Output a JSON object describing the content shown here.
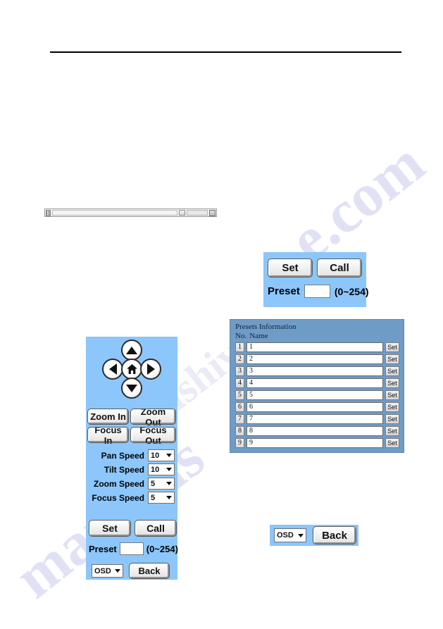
{
  "watermark": {
    "line_right": "e.com",
    "line_left": "manuals",
    "line_mid": "alshive"
  },
  "toolbar_strip": {
    "grip_icon": "drag-grip-icon",
    "mini_icon": "spinner-icon",
    "field_value": "",
    "end_icon": "resize-handle-icon"
  },
  "preset_panel": {
    "set_label": "Set",
    "call_label": "Call",
    "preset_label": "Preset",
    "preset_value": "",
    "preset_placeholder": "",
    "range_hint": "(0~254)"
  },
  "osd_panel": {
    "osd_selected": "OSD",
    "back_label": "Back"
  },
  "ptz_panel": {
    "nav": {
      "up_icon": "arrow-up-icon",
      "left_icon": "arrow-left-icon",
      "home_icon": "home-icon",
      "right_icon": "arrow-right-icon",
      "down_icon": "arrow-down-icon"
    },
    "zoom_in_label": "Zoom In",
    "zoom_out_label": "Zoom Out",
    "focus_in_label": "Focus In",
    "focus_out_label": "Focus Out",
    "speeds": [
      {
        "label": "Pan Speed",
        "value": "10"
      },
      {
        "label": "Tilt Speed",
        "value": "10"
      },
      {
        "label": "Zoom Speed",
        "value": "5"
      },
      {
        "label": "Focus Speed",
        "value": "5"
      }
    ],
    "set_label": "Set",
    "call_label": "Call",
    "preset_label": "Preset",
    "preset_value": "",
    "range_hint": "(0~254)",
    "osd_selected": "OSD",
    "back_label": "Back"
  },
  "presets_table": {
    "title": "Presets Information",
    "col_no": "No.",
    "col_name": "Name",
    "set_label": "Set",
    "rows": [
      {
        "no": "1",
        "name": "1"
      },
      {
        "no": "2",
        "name": "2"
      },
      {
        "no": "3",
        "name": "3"
      },
      {
        "no": "4",
        "name": "4"
      },
      {
        "no": "5",
        "name": "5"
      },
      {
        "no": "6",
        "name": "6"
      },
      {
        "no": "7",
        "name": "7"
      },
      {
        "no": "8",
        "name": "8"
      },
      {
        "no": "9",
        "name": "9"
      }
    ]
  },
  "colors": {
    "panel_blue": "#8cc6fb",
    "table_blue": "#6f9bc7",
    "watermark": "#c9c9ef"
  }
}
